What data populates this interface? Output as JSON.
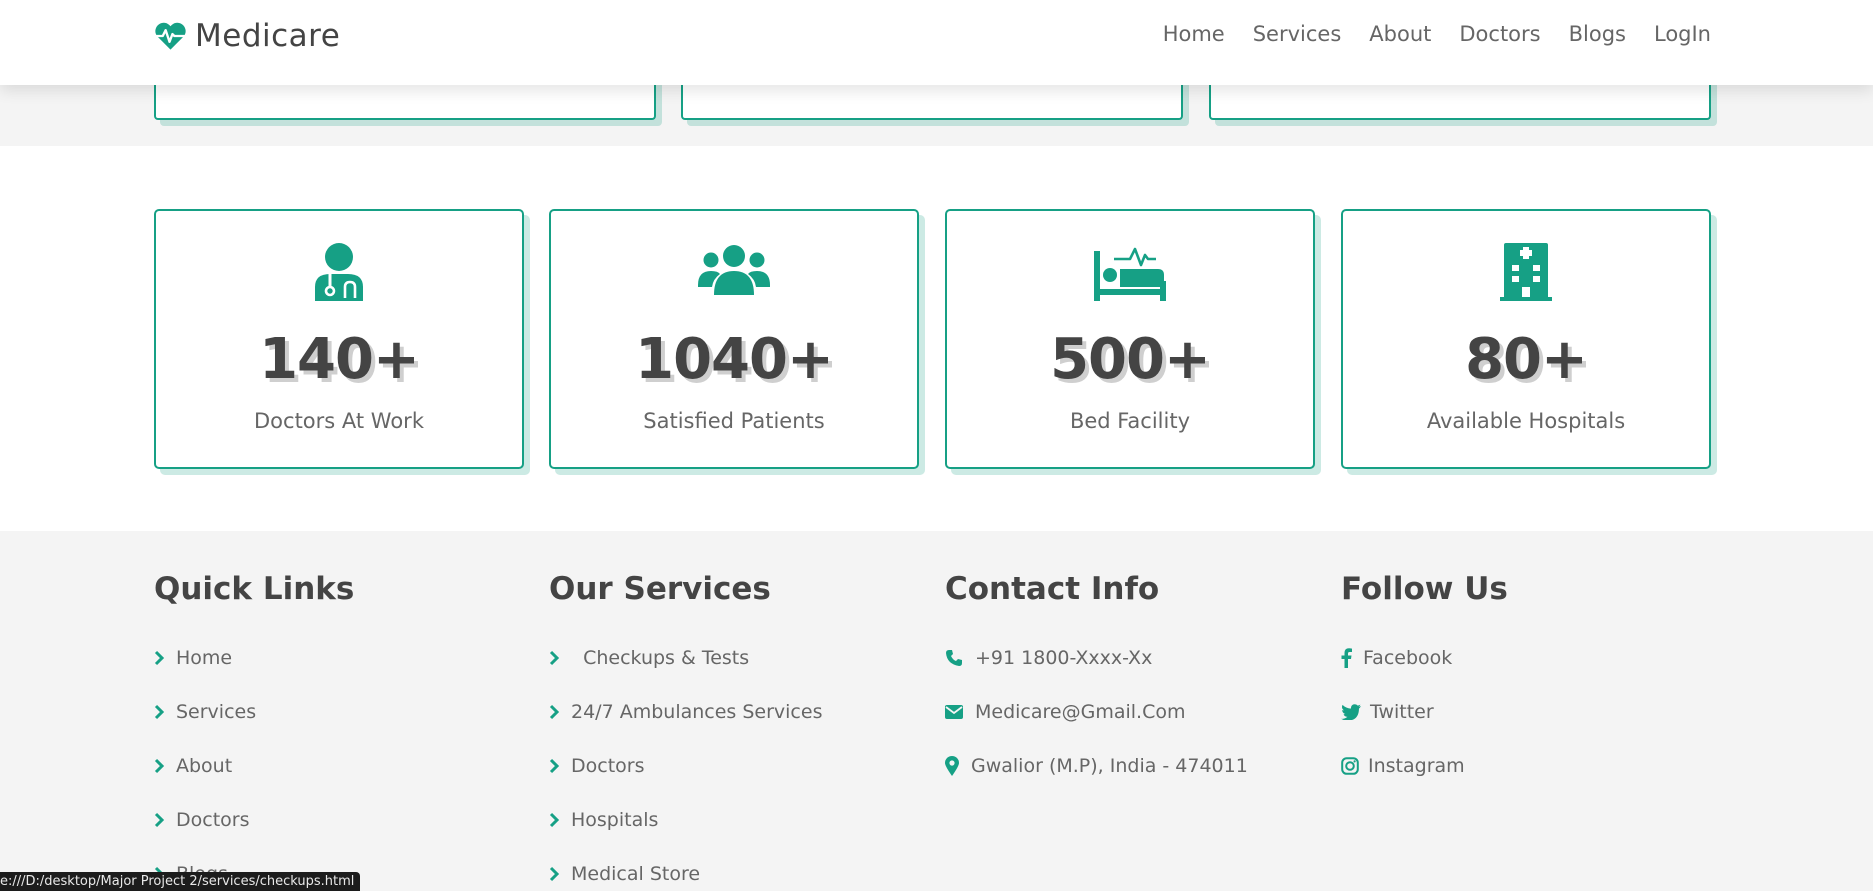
{
  "header": {
    "brand": "Medicare",
    "nav": [
      "Home",
      "Services",
      "About",
      "Doctors",
      "Blogs",
      "LogIn"
    ]
  },
  "stats": [
    {
      "value": "140+",
      "label": "Doctors At Work",
      "icon": "user-doctor-icon"
    },
    {
      "value": "1040+",
      "label": "Satisfied Patients",
      "icon": "users-icon"
    },
    {
      "value": "500+",
      "label": "Bed Facility",
      "icon": "bed-pulse-icon"
    },
    {
      "value": "80+",
      "label": "Available Hospitals",
      "icon": "hospital-icon"
    }
  ],
  "footer": {
    "quick_links": {
      "title": "Quick Links",
      "items": [
        "Home",
        "Services",
        "About",
        "Doctors",
        "Blogs"
      ]
    },
    "services": {
      "title": "Our Services",
      "items": [
        "  Checkups & Tests",
        "24/7 Ambulances Services",
        "Doctors",
        "Hospitals",
        "Medical Store"
      ]
    },
    "contact": {
      "title": "Contact Info",
      "items": [
        {
          "text": "+91 1800-Xxxx-Xx",
          "icon": "phone-icon"
        },
        {
          "text": "Medicare@Gmail.Com",
          "icon": "envelope-icon"
        },
        {
          "text": "Gwalior (M.P), India - 474011",
          "icon": "map-marker-icon"
        }
      ]
    },
    "follow": {
      "title": "Follow Us",
      "items": [
        {
          "text": "Facebook",
          "icon": "facebook-icon"
        },
        {
          "text": "Twitter",
          "icon": "twitter-icon"
        },
        {
          "text": "Instagram",
          "icon": "instagram-icon"
        }
      ]
    }
  },
  "status_bar": "e:///D:/desktop/Major Project 2/services/checkups.html",
  "colors": {
    "accent": "#16a085",
    "text": "#444444",
    "muted": "#666666",
    "band": "#f4f4f4"
  }
}
